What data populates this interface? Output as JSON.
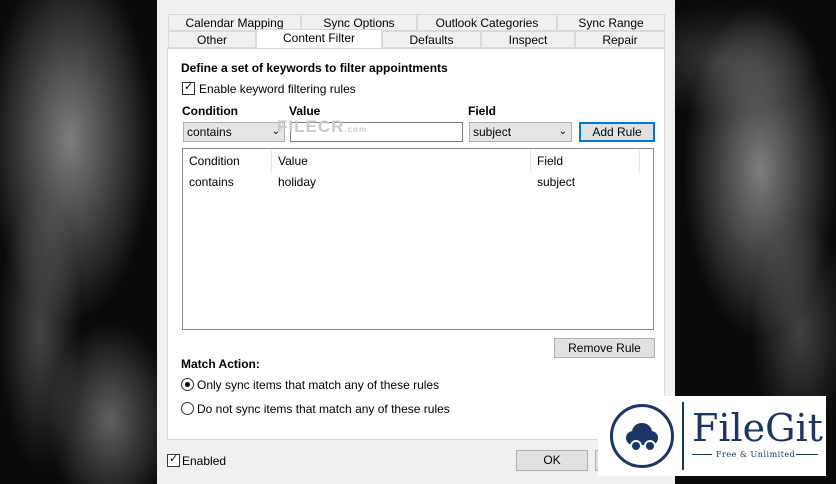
{
  "tabs_row1": [
    "Calendar Mapping",
    "Sync Options",
    "Outlook Categories",
    "Sync Range"
  ],
  "tabs_row2": [
    "Other",
    "Content Filter",
    "Defaults",
    "Inspect",
    "Repair"
  ],
  "active_tab": "Content Filter",
  "content_filter": {
    "heading": "Define a set of keywords to filter appointments",
    "enable_label": "Enable keyword filtering rules",
    "enable_checked": true,
    "condition_label": "Condition",
    "value_label": "Value",
    "field_label": "Field",
    "condition_value": "contains",
    "value_input": "",
    "field_value": "subject",
    "add_rule_label": "Add Rule",
    "list_columns": [
      "Condition",
      "Value",
      "Field"
    ],
    "rules": [
      {
        "condition": "contains",
        "value": "holiday",
        "field": "subject"
      }
    ],
    "remove_rule_label": "Remove Rule",
    "match_action_label": "Match Action:",
    "match_options": [
      {
        "label": "Only sync items that match any of these rules",
        "selected": true
      },
      {
        "label": "Do not sync items that match any of these rules",
        "selected": false
      }
    ]
  },
  "footer": {
    "enabled_label": "Enabled",
    "enabled_checked": true,
    "ok_label": "OK"
  },
  "watermark": {
    "text": "FILECR",
    "sub": ".com"
  },
  "logo": {
    "name": "FileGit",
    "tagline": "Free & Unlimited"
  },
  "colors": {
    "accent": "#0078d7",
    "logo": "#1a3566"
  }
}
